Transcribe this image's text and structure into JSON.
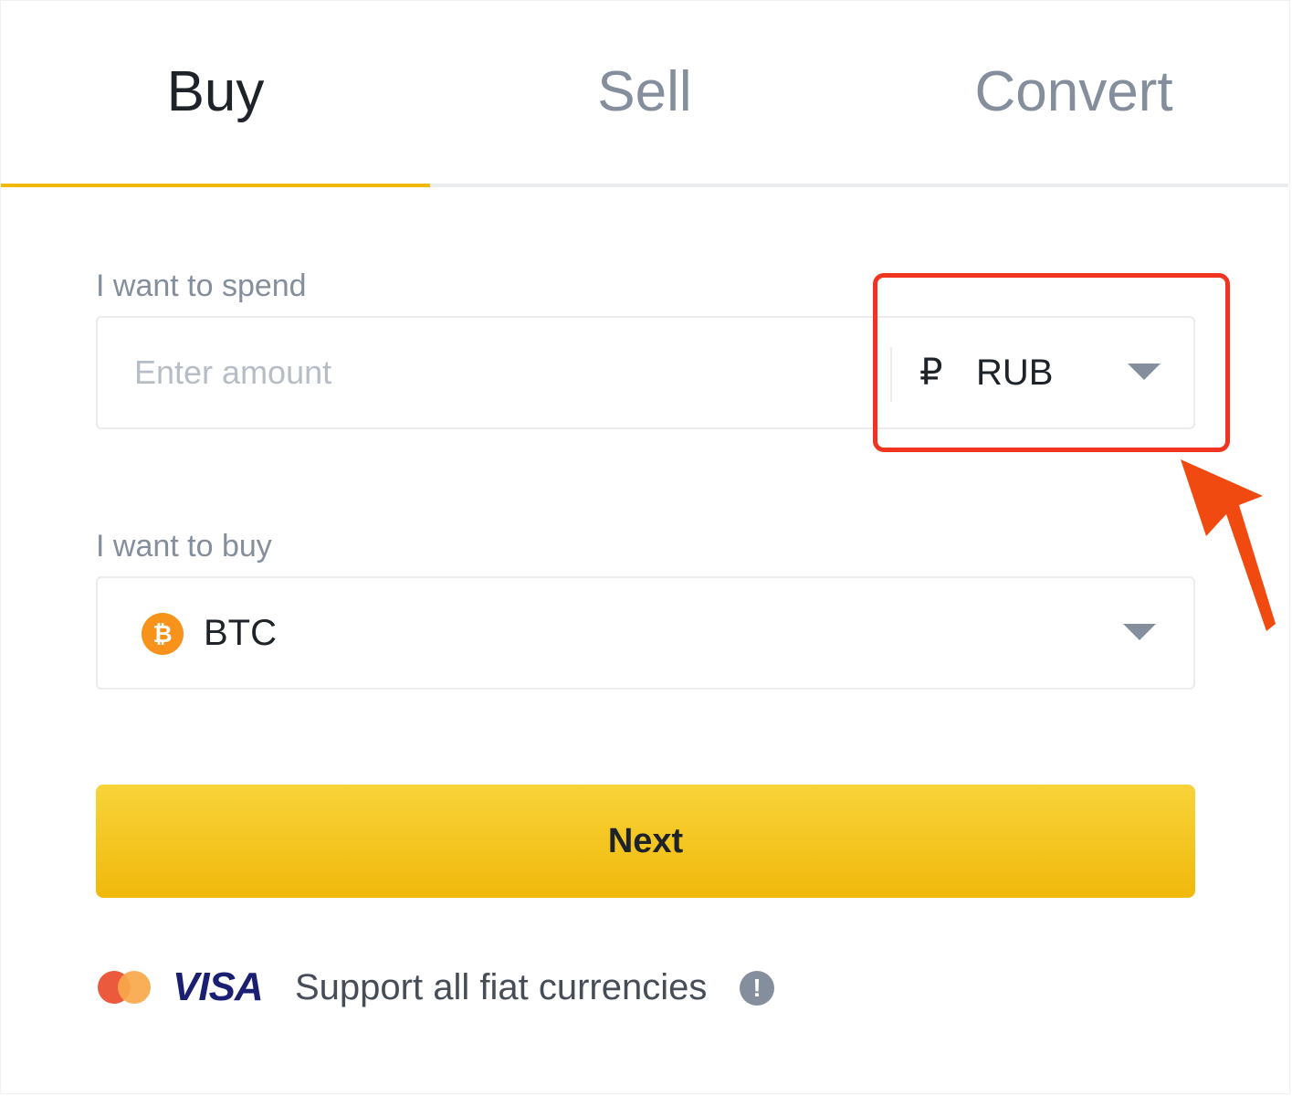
{
  "tabs": [
    {
      "label": "Buy",
      "active": true
    },
    {
      "label": "Sell",
      "active": false
    },
    {
      "label": "Convert",
      "active": false
    }
  ],
  "spend": {
    "label": "I want to spend",
    "placeholder": "Enter amount",
    "value": "",
    "currency_symbol": "₽",
    "currency": "RUB"
  },
  "buy": {
    "label": "I want to buy",
    "coin_symbol": "₿",
    "coin": "BTC"
  },
  "next_label": "Next",
  "footer": {
    "visa": "VISA",
    "text": "Support all fiat currencies",
    "info_glyph": "!"
  },
  "colors": {
    "accent": "#f0b90b",
    "highlight": "#f0341f",
    "btc": "#f7931a",
    "text_primary": "#1e2329",
    "text_secondary": "#848e9c"
  },
  "icons": {
    "currency_caret": "chevron-down-icon",
    "coin_caret": "chevron-down-icon",
    "coin": "bitcoin-icon",
    "card": "mastercard-icon",
    "info": "info-icon"
  }
}
